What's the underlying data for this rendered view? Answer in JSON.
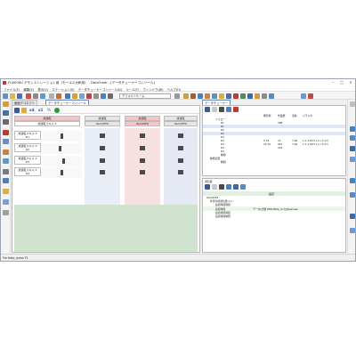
{
  "window": {
    "title": "FUJISOKU デモンストレーション用（モールス大和用） - DataTuner - [データチューナーコンソール]"
  },
  "menu": [
    "ファイル(F)",
    "編集(E)",
    "表示(V)",
    "ステーション(S)",
    "データチューナーコンソール(D)",
    "ツール(T)",
    "ウィンドウ(W)",
    "ヘルプ(H)"
  ],
  "toolbar": {
    "combo_value": "デフォルトルーム"
  },
  "tabs": {
    "left_1": "画面デコネクト",
    "left_2": "データチューナーコンソール",
    "right_1": "データチューナー"
  },
  "subtool": {
    "x4": "x4",
    "x1": "x1",
    "quarter": "¼"
  },
  "grid": {
    "top_header": "試運転",
    "top_sub": "試運転スキル X",
    "columns": [
      {
        "label": "試運転",
        "sub": "Item05F6"
      },
      {
        "label": "試運転",
        "sub": "Item05F6"
      },
      {
        "label": "試運転",
        "sub": "Item05F6"
      }
    ],
    "rows": [
      {
        "label": "試運転スキル X",
        "sub": "R1"
      },
      {
        "label": "試運転スキル X",
        "sub": "R2"
      },
      {
        "label": "試運転スキル X",
        "sub": "R3"
      },
      {
        "label": "試運転スキル X",
        "sub": "R4"
      }
    ]
  },
  "tuner_table": {
    "headers": [
      "概況値",
      "作業群",
      "変動",
      "パラメタ"
    ],
    "rows": [
      {
        "name": "フォロー",
        "vals": [
          "",
          "",
          "",
          ""
        ]
      },
      {
        "name": "R1",
        "vals": [
          "",
          "388",
          "",
          ""
        ]
      },
      {
        "name": "R1",
        "vals": [
          "",
          "",
          "",
          ""
        ]
      },
      {
        "name": "R2",
        "vals": [
          "",
          "",
          "",
          ""
        ]
      },
      {
        "name": "R2",
        "vals": [
          "",
          "",
          "",
          ""
        ]
      },
      {
        "name": "R3",
        "vals": [
          "",
          "",
          "",
          ""
        ]
      },
      {
        "name": "R3",
        "vals": [
          "5.76",
          "71",
          "7.96",
          "1.1  5.63*1(-1)·(7.17)"
        ]
      },
      {
        "name": "R4",
        "vals": [
          "10.76",
          "287",
          "7.96",
          "1.1  5.60*1(-1)·(3.17)"
        ]
      },
      {
        "name": "R4",
        "vals": [
          "",
          "218",
          "",
          ""
        ]
      },
      {
        "name": "R4",
        "vals": [
          "",
          "",
          "",
          ""
        ]
      },
      {
        "name": "種類",
        "vals": [
          "",
          "",
          "",
          ""
        ]
      },
      {
        "name": "種類",
        "vals": [
          "",
          "",
          "",
          ""
        ]
      }
    ],
    "section_2": "種類変更"
  },
  "props": {
    "title": "通信器",
    "col_label": "設定",
    "group": "Item05F6",
    "subgroup": "外部付加通信量 [1]",
    "items": [
      {
        "name": "接続時間時間",
        "value": ""
      },
      {
        "name": "接続時間",
        "value": "データ(計量 PRE)/Ntop_N カ/Newness"
      },
      {
        "name": "接続時間時間",
        "value": ""
      },
      {
        "name": "接続時間制限",
        "value": ""
      }
    ]
  },
  "status": {
    "text": "For Help, press F1"
  }
}
